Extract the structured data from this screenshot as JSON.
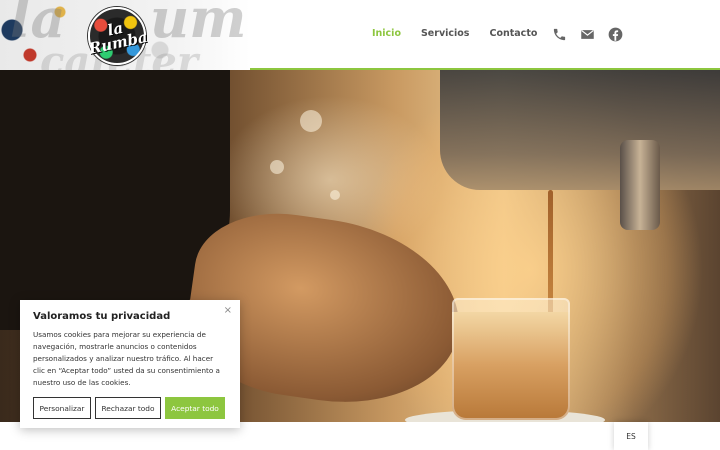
{
  "header": {
    "logo_text": "la Rumba",
    "mural_text": "la Rumba cafetería",
    "accent_color": "#8dc63f"
  },
  "nav": {
    "items": [
      {
        "label": "Inicio",
        "active": true
      },
      {
        "label": "Servicios",
        "active": false
      },
      {
        "label": "Contacto",
        "active": false
      }
    ]
  },
  "social": {
    "icons": [
      "phone-icon",
      "envelope-icon",
      "facebook-icon"
    ]
  },
  "hero": {
    "image": "barista-pouring-espresso"
  },
  "cookie_banner": {
    "title": "Valoramos tu privacidad",
    "close_symbol": "×",
    "body": "Usamos cookies para mejorar su experiencia de navegación, mostrarle anuncios o contenidos personalizados y analizar nuestro tráfico. Al hacer clic en “Aceptar todo” usted da su consentimiento a nuestro uso de las cookies.",
    "buttons": {
      "customize": "Personalizar",
      "reject": "Rechazar todo",
      "accept": "Aceptar todo"
    }
  },
  "language": {
    "current": "ES"
  }
}
